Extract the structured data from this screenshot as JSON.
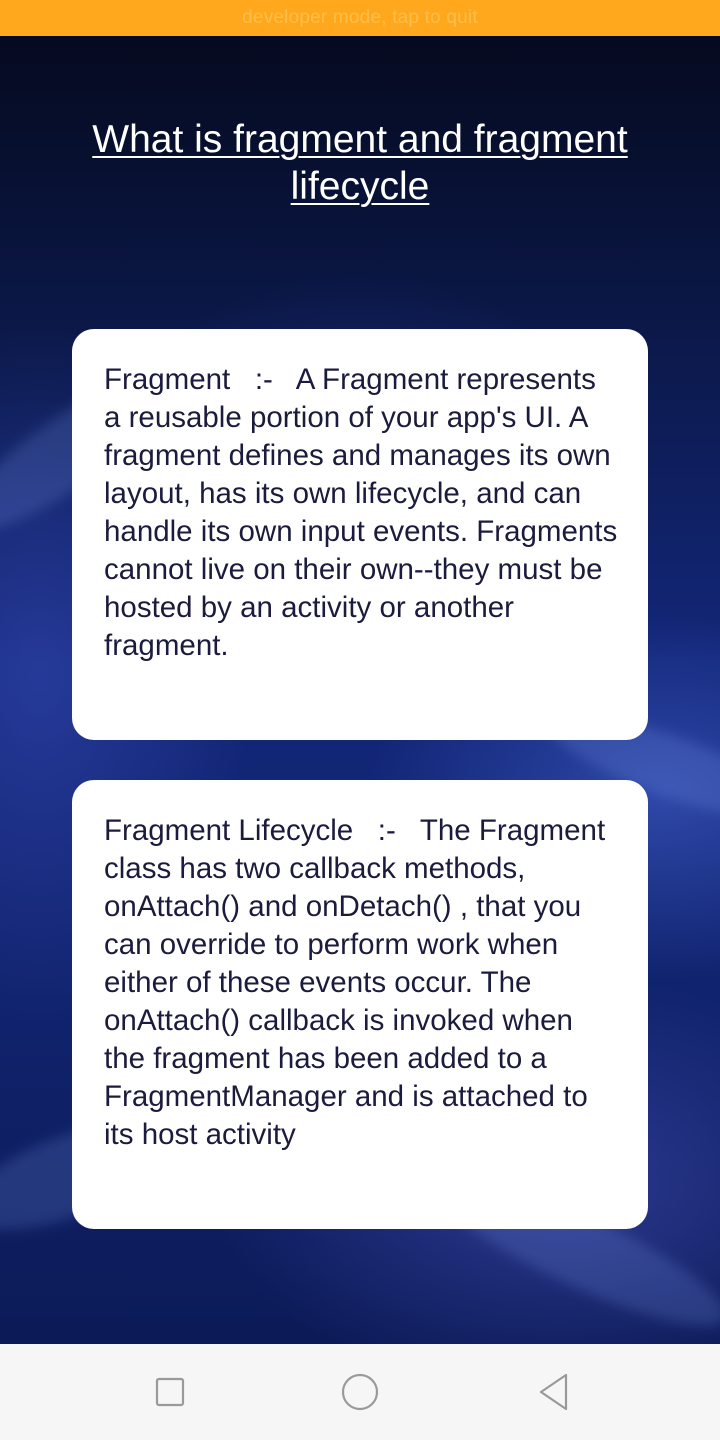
{
  "status_bar": {
    "dev_mode_text": "developer mode, tap to quit"
  },
  "page": {
    "title": "What is fragment and fragment lifecycle"
  },
  "cards": [
    {
      "text": "Fragment   :-   A Fragment represents a reusable portion of your app's UI. A fragment defines and manages its own layout, has its own lifecycle, and can handle its own input events. Fragments cannot live on their own--they must be hosted by an activity or another fragment."
    },
    {
      "text": "Fragment Lifecycle   :-   The Fragment class has two callback methods, onAttach() and onDetach() , that you can override to perform work when either of these events occur. The onAttach() callback is invoked when the fragment has been added to a FragmentManager and is attached to its host activity"
    }
  ],
  "nav_bar": {
    "buttons": [
      {
        "icon": "square-recents-icon"
      },
      {
        "icon": "circle-home-icon"
      },
      {
        "icon": "triangle-back-icon"
      }
    ]
  },
  "colors": {
    "dev_bar": "#ffa81e",
    "background_top": "#050a1f",
    "background_mid": "#13277a",
    "card_bg": "#ffffff",
    "card_text": "#1b1b3d",
    "title_text": "#ffffff",
    "nav_bar": "#f6f6f6",
    "nav_icon": "#9a9a9a"
  }
}
